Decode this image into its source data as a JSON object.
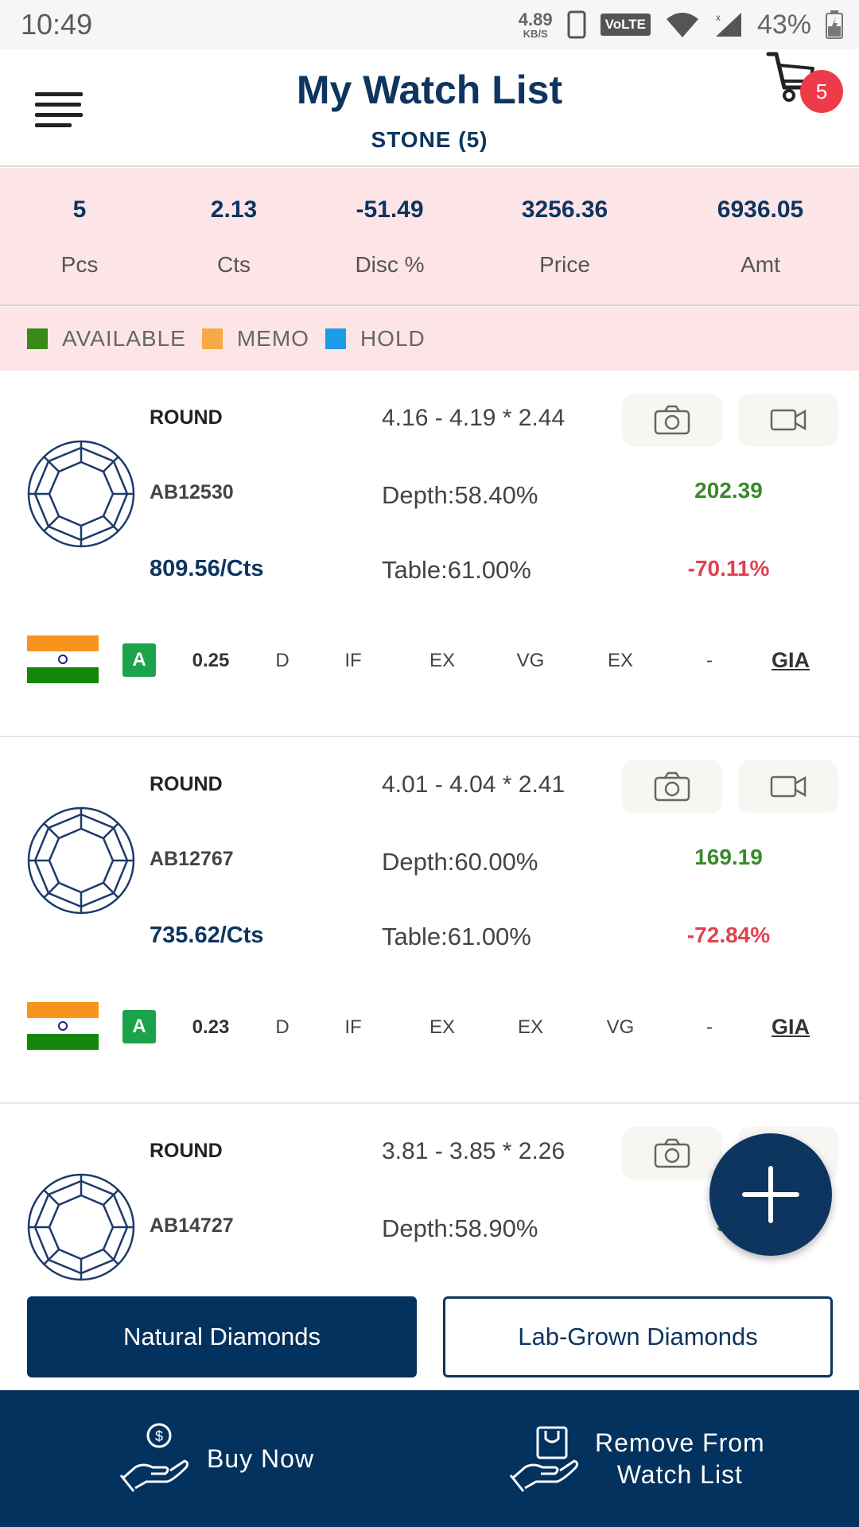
{
  "status_bar": {
    "time": "10:49",
    "net_speed": "4.89",
    "net_speed_unit": "KB/S",
    "network_badge": "VoLTE",
    "battery": "43%"
  },
  "header": {
    "title": "My Watch List",
    "subtitle": "STONE (5)",
    "cart_count": "5"
  },
  "summary": [
    {
      "value": "5",
      "label": "Pcs"
    },
    {
      "value": "2.13",
      "label": "Cts"
    },
    {
      "value": "-51.49",
      "label": "Disc %"
    },
    {
      "value": "3256.36",
      "label": "Price"
    },
    {
      "value": "6936.05",
      "label": "Amt"
    }
  ],
  "legend": [
    {
      "label": "AVAILABLE",
      "color": "#3a8a1a"
    },
    {
      "label": "MEMO",
      "color": "#f7a945"
    },
    {
      "label": "HOLD",
      "color": "#1e9be8"
    }
  ],
  "items": [
    {
      "shape": "ROUND",
      "stone_id": "AB12530",
      "price_per_ct": "809.56/Cts",
      "measurements": "4.16 - 4.19 * 2.44",
      "depth": "Depth:58.40%",
      "table": "Table:61.00%",
      "amount": "202.39",
      "discount": "-70.11%",
      "availability": "A",
      "carat": "0.25",
      "color": "D",
      "clarity": "IF",
      "cut": "EX",
      "polish": "VG",
      "symmetry": "EX",
      "fluorescence": "-",
      "lab": "GIA"
    },
    {
      "shape": "ROUND",
      "stone_id": "AB12767",
      "price_per_ct": "735.62/Cts",
      "measurements": "4.01 - 4.04 * 2.41",
      "depth": "Depth:60.00%",
      "table": "Table:61.00%",
      "amount": "169.19",
      "discount": "-72.84%",
      "availability": "A",
      "carat": "0.23",
      "color": "D",
      "clarity": "IF",
      "cut": "EX",
      "polish": "EX",
      "symmetry": "VG",
      "fluorescence": "-",
      "lab": "GIA"
    },
    {
      "shape": "ROUND",
      "stone_id": "AB14727",
      "measurements": "3.81 - 3.85 * 2.26",
      "depth": "Depth:58.90%",
      "amount_partial": "95"
    }
  ],
  "categories": {
    "active": "Natural Diamonds",
    "inactive": "Lab-Grown Diamonds"
  },
  "actions": {
    "buy_now": "Buy Now",
    "remove_line1": "Remove From",
    "remove_line2": "Watch List"
  }
}
